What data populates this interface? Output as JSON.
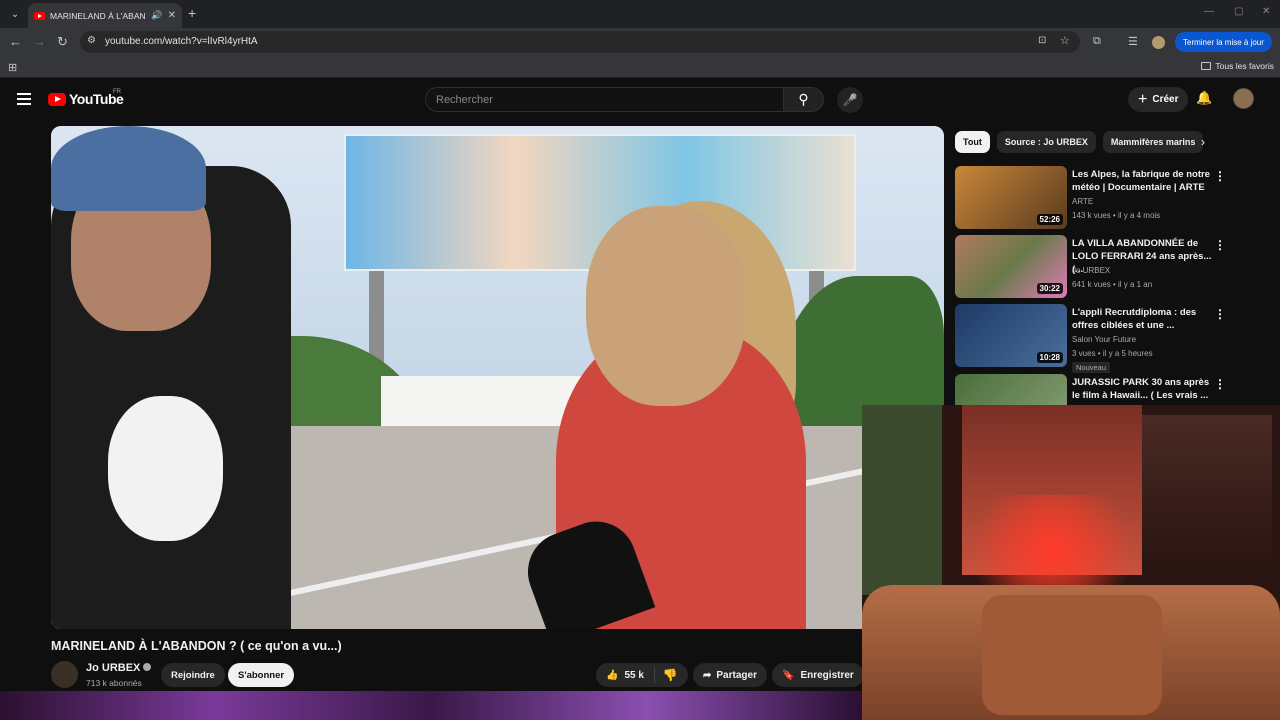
{
  "browser": {
    "tab_title": "MARINELAND À L'ABANDON ? ( ce qu'on a vu...)",
    "url": "youtube.com/watch?v=lIvRl4yrHtA",
    "update_button": "Terminer la mise à jour",
    "bookmarks_all": "Tous les favoris"
  },
  "youtube": {
    "logo_text": "YouTube",
    "region": "FR",
    "search_placeholder": "Rechercher",
    "create_label": "Créer"
  },
  "video": {
    "title": "MARINELAND À L'ABANDON ? ( ce qu'on a vu...)",
    "channel": "Jo URBEX",
    "subscribers": "713 k abonnés",
    "join_label": "Rejoindre",
    "subscribe_label": "S'abonner",
    "likes": "55 k",
    "share_label": "Partager",
    "save_label": "Enregistrer"
  },
  "chips": [
    "Tout",
    "Source : Jo URBEX",
    "Mammifères marins"
  ],
  "recommendations": [
    {
      "title": "Les Alpes, la fabrique de notre météo | Documentaire | ARTE",
      "channel": "ARTE",
      "meta": "143 k vues • il y a 4 mois",
      "duration": "52:26",
      "thumb_color": "#8a5a2a",
      "badge": ""
    },
    {
      "title": "LA VILLA ABANDONNÉE de LOLO FERRARI 24 ans après...(...",
      "channel": "Jo URBEX",
      "meta": "641 k vues • il y a 1 an",
      "duration": "30:22",
      "thumb_color": "#6a7a4a",
      "badge": ""
    },
    {
      "title": "L'appli Recrutdiploma : des offres ciblées et une ...",
      "channel": "Salon Your Future",
      "meta": "3 vues • il y a 5 heures",
      "duration": "10:28",
      "thumb_color": "#2c4e7a",
      "badge": "Nouveau"
    },
    {
      "title": "JURASSIC PARK 30 ans après le film à Hawaii... ( Les vrais ...",
      "channel": "",
      "meta": "",
      "duration": "",
      "thumb_color": "#4a6e3a",
      "badge": ""
    }
  ]
}
